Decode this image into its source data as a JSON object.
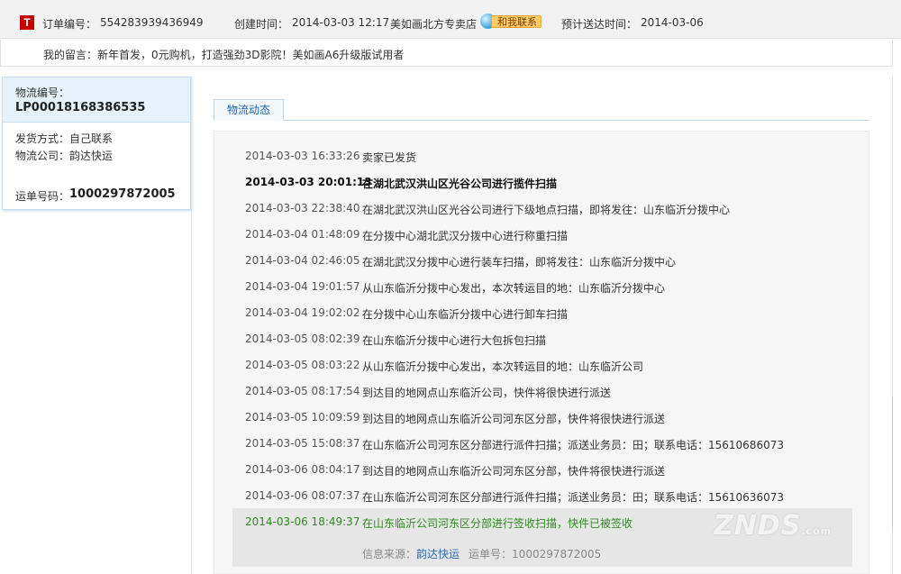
{
  "order": {
    "logo_char": "T",
    "order_no_label": "订单编号：",
    "order_no": "554283939436949",
    "created_label": "创建时间：",
    "created": "2014-03-03 12:17",
    "shop": "美如画北方专卖店",
    "contact_label": "和我联系",
    "eta_label": "预计送达时间：",
    "eta": "2014-03-06"
  },
  "message": {
    "text": "我的留言：新年首发，0元购机，打造强劲3D影院！美如画A6升级版试用者"
  },
  "logistics": {
    "no_label": "物流编号：",
    "no": "LP00018168386535",
    "method_label": "发货方式：",
    "method": "自己联系",
    "company_label": "物流公司：",
    "company": "韵达快运",
    "waybill_label": "运单号码：",
    "waybill": "1000297872005"
  },
  "tab": {
    "label": "物流动态"
  },
  "events": [
    {
      "time": "2014-03-03 16:33:26",
      "desc": "卖家已发货"
    },
    {
      "time": "2014-03-03 20:01:13",
      "desc": "在湖北武汉洪山区光谷公司进行揽件扫描"
    },
    {
      "time": "2014-03-03 22:38:40",
      "desc": "在湖北武汉洪山区光谷公司进行下级地点扫描，即将发往：山东临沂分拨中心"
    },
    {
      "time": "2014-03-04 01:48:09",
      "desc": "在分拨中心湖北武汉分拨中心进行称重扫描"
    },
    {
      "time": "2014-03-04 02:46:05",
      "desc": "在湖北武汉分拨中心进行装车扫描，即将发往：山东临沂分拨中心"
    },
    {
      "time": "2014-03-04 19:01:57",
      "desc": "从山东临沂分拨中心发出，本次转运目的地：山东临沂分拨中心"
    },
    {
      "time": "2014-03-04 19:02:02",
      "desc": "在分拨中心山东临沂分拨中心进行卸车扫描"
    },
    {
      "time": "2014-03-05 08:02:39",
      "desc": "在山东临沂分拨中心进行大包拆包扫描"
    },
    {
      "time": "2014-03-05 08:03:22",
      "desc": "从山东临沂分拨中心发出，本次转运目的地：山东临沂公司"
    },
    {
      "time": "2014-03-05 08:17:54",
      "desc": "到达目的地网点山东临沂公司，快件将很快进行派送"
    },
    {
      "time": "2014-03-05 10:09:59",
      "desc": "到达目的地网点山东临沂公司河东区分部，快件将很快进行派送"
    },
    {
      "time": "2014-03-05 15:08:37",
      "desc": "在山东临沂公司河东区分部进行派件扫描；派送业务员：田；联系电话：15610686073"
    },
    {
      "time": "2014-03-06 08:04:17",
      "desc": "到达目的地网点山东临沂公司河东区分部，快件将很快进行派送"
    },
    {
      "time": "2014-03-06 08:07:37",
      "desc": "在山东临沂公司河东区分部进行派件扫描；派送业务员：田；联系电话：15610636073"
    },
    {
      "time": "2014-03-06 18:49:37",
      "desc": "在山东临沂公司河东区分部进行签收扫描，快件已被签收"
    }
  ],
  "source": {
    "label": "信息来源：",
    "carrier": "韵达快运",
    "waybill_label": "运单号：",
    "waybill": "1000297872005"
  },
  "watermark": {
    "text": "ZNDS",
    "suffix": ".com"
  },
  "colors": {
    "link": "#2b6bb3",
    "signed": "#2e8b1f",
    "logo": "#c40000"
  }
}
